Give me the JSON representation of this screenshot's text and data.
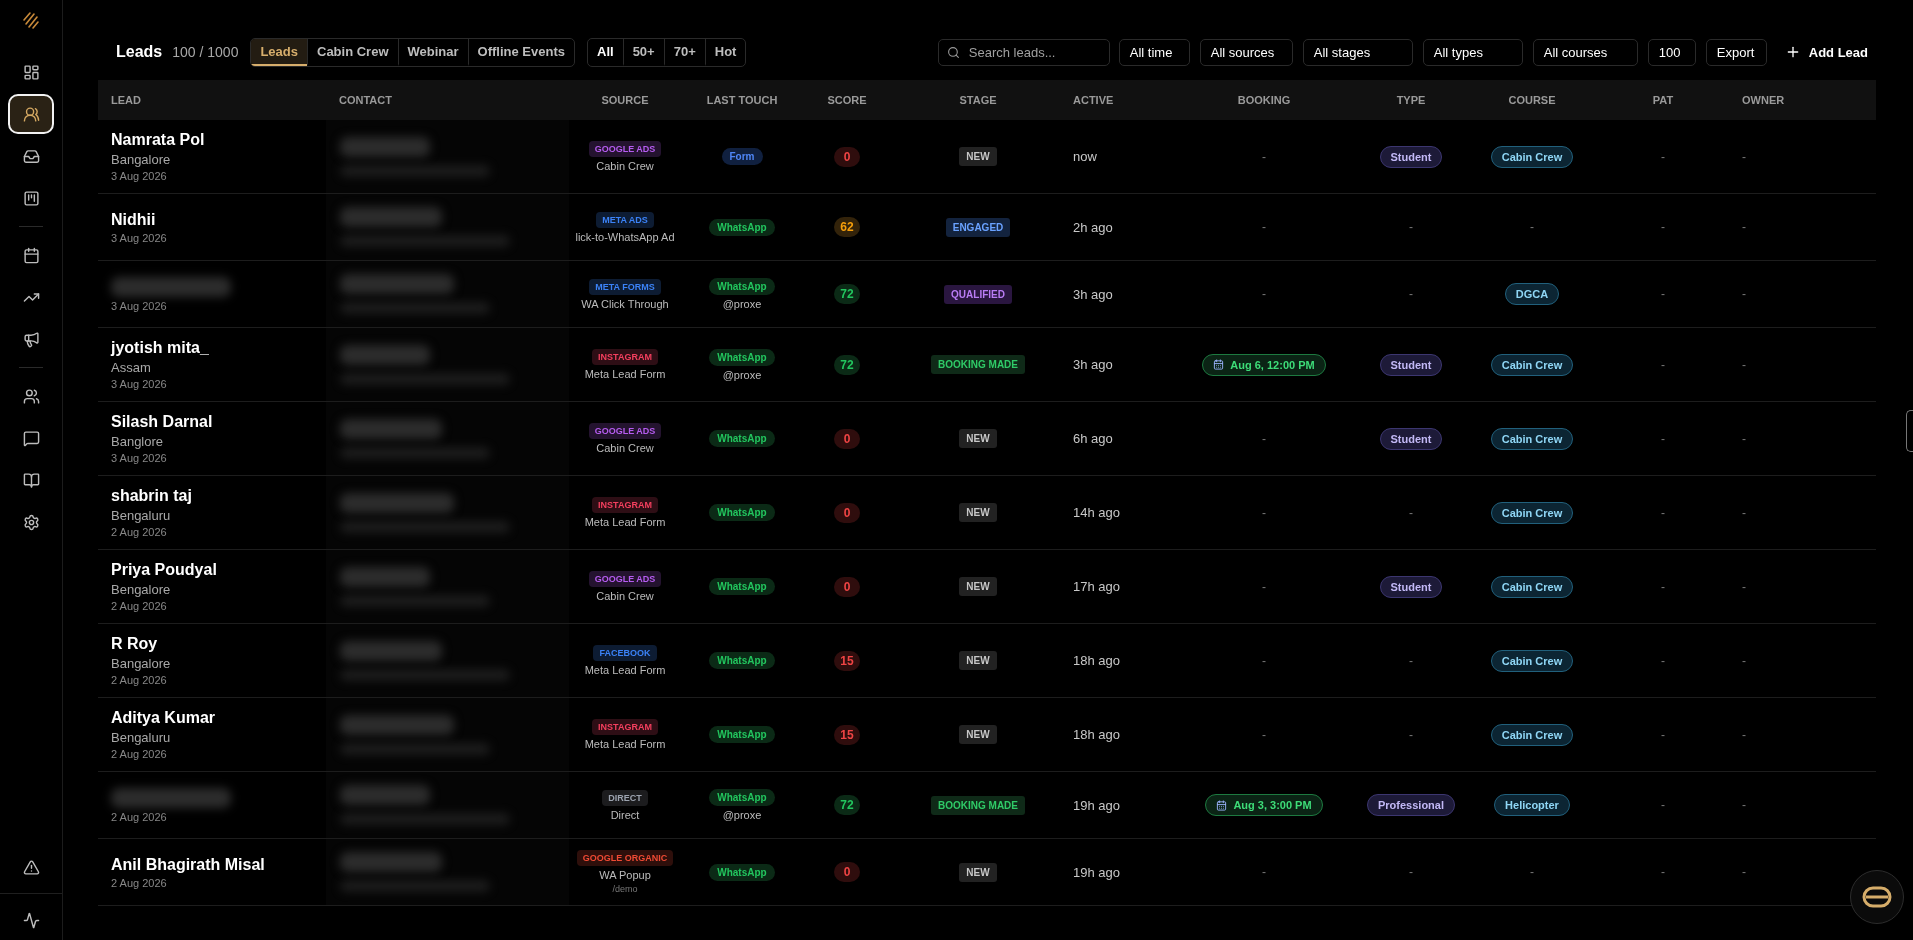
{
  "sidebar": {
    "items": [
      {
        "kind": "dashboard",
        "selected": false
      },
      {
        "kind": "leads",
        "selected": true
      },
      {
        "kind": "inbox",
        "selected": false
      },
      {
        "kind": "board",
        "selected": false
      },
      {
        "kind": "divider"
      },
      {
        "kind": "calendar",
        "selected": false
      },
      {
        "kind": "trend",
        "selected": false
      },
      {
        "kind": "megaphone",
        "selected": false
      },
      {
        "kind": "divider"
      },
      {
        "kind": "users",
        "selected": false
      },
      {
        "kind": "chat",
        "selected": false
      },
      {
        "kind": "book",
        "selected": false
      },
      {
        "kind": "settings",
        "selected": false
      }
    ],
    "bottom": [
      {
        "kind": "warning",
        "selected": false
      },
      {
        "kind": "pulse",
        "selected": false
      }
    ]
  },
  "header": {
    "title": "Leads",
    "count": "100 / 1000",
    "tabs": [
      {
        "label": "Leads",
        "selected": true
      },
      {
        "label": "Cabin Crew",
        "selected": false
      },
      {
        "label": "Webinar",
        "selected": false
      },
      {
        "label": "Offline Events",
        "selected": false
      }
    ],
    "score_filters": [
      {
        "label": "All",
        "selected": true
      },
      {
        "label": "50+",
        "selected": false
      },
      {
        "label": "70+",
        "selected": false
      },
      {
        "label": "Hot",
        "selected": false
      }
    ],
    "search": {
      "placeholder": "Search leads..."
    },
    "filters": [
      {
        "label": "All time",
        "kind": "time"
      },
      {
        "label": "All sources",
        "kind": "sources"
      },
      {
        "label": "All stages",
        "kind": "stages"
      },
      {
        "label": "All types",
        "kind": "types"
      },
      {
        "label": "All courses",
        "kind": "courses"
      },
      {
        "label": "100",
        "kind": "limit"
      }
    ],
    "export": "Export",
    "add": "Add Lead"
  },
  "table": {
    "columns": [
      "LEAD",
      "CONTACT",
      "SOURCE",
      "LAST TOUCH",
      "SCORE",
      "STAGE",
      "ACTIVE",
      "BOOKING",
      "TYPE",
      "COURSE",
      "PAT",
      "OWNER"
    ],
    "rows": [
      {
        "name": "Namrata Pol",
        "city": "Bangalore",
        "date": "3 Aug 2026",
        "source": {
          "tag": "GOOGLE ADS",
          "kind": "google_ads",
          "detail": "Cabin Crew"
        },
        "touch": {
          "label": "Form",
          "kind": "form"
        },
        "score": {
          "value": "0",
          "kind": "low"
        },
        "stage": {
          "label": "NEW",
          "kind": "new"
        },
        "active": "now",
        "booking": {
          "kind": "none",
          "label": "-"
        },
        "type": {
          "kind": "chip",
          "label": "Student"
        },
        "course": {
          "kind": "chip",
          "label": "Cabin Crew"
        },
        "pat": "-",
        "owner": "-"
      },
      {
        "name": "Nidhii",
        "date": "3 Aug 2026",
        "source": {
          "tag": "META ADS",
          "kind": "meta",
          "detail": "lick-to-WhatsApp Ad"
        },
        "touch": {
          "label": "WhatsApp",
          "kind": "whatsapp"
        },
        "score": {
          "value": "62",
          "kind": "mid"
        },
        "stage": {
          "label": "ENGAGED",
          "kind": "engaged"
        },
        "active": "2h ago",
        "booking": {
          "kind": "none",
          "label": "-"
        },
        "type": {
          "kind": "none",
          "label": "-"
        },
        "course": {
          "kind": "none",
          "label": "-"
        },
        "pat": "-",
        "owner": "-"
      },
      {
        "name_hidden": true,
        "date": "3 Aug 2026",
        "source": {
          "tag": "META FORMS",
          "kind": "meta",
          "detail": "WA Click Through"
        },
        "touch": {
          "label": "WhatsApp",
          "kind": "whatsapp",
          "handle": "@proxe"
        },
        "score": {
          "value": "72",
          "kind": "high"
        },
        "stage": {
          "label": "QUALIFIED",
          "kind": "qualified"
        },
        "active": "3h ago",
        "booking": {
          "kind": "none",
          "label": "-"
        },
        "type": {
          "kind": "none",
          "label": "-"
        },
        "course": {
          "kind": "chip",
          "label": "DGCA"
        },
        "pat": "-",
        "owner": "-"
      },
      {
        "name": "jyotish mita_",
        "city": "Assam",
        "date": "3 Aug 2026",
        "source": {
          "tag": "INSTAGRAM",
          "kind": "instagram",
          "detail": "Meta Lead Form"
        },
        "touch": {
          "label": "WhatsApp",
          "kind": "whatsapp",
          "handle": "@proxe"
        },
        "score": {
          "value": "72",
          "kind": "high"
        },
        "stage": {
          "label": "BOOKING MADE",
          "kind": "booking"
        },
        "active": "3h ago",
        "booking": {
          "kind": "chip",
          "label": "Aug 6, 12:00 PM"
        },
        "type": {
          "kind": "chip",
          "label": "Student"
        },
        "course": {
          "kind": "chip",
          "label": "Cabin Crew"
        },
        "pat": "-",
        "owner": "-"
      },
      {
        "name": "Silash Darnal",
        "city": "Banglore",
        "date": "3 Aug 2026",
        "source": {
          "tag": "GOOGLE ADS",
          "kind": "google_ads",
          "detail": "Cabin Crew"
        },
        "touch": {
          "label": "WhatsApp",
          "kind": "whatsapp"
        },
        "score": {
          "value": "0",
          "kind": "low"
        },
        "stage": {
          "label": "NEW",
          "kind": "new"
        },
        "active": "6h ago",
        "booking": {
          "kind": "none",
          "label": "-"
        },
        "type": {
          "kind": "chip",
          "label": "Student"
        },
        "course": {
          "kind": "chip",
          "label": "Cabin Crew"
        },
        "pat": "-",
        "owner": "-"
      },
      {
        "name": "shabrin taj",
        "city": "Bengaluru",
        "date": "2 Aug 2026",
        "source": {
          "tag": "INSTAGRAM",
          "kind": "instagram",
          "detail": "Meta Lead Form"
        },
        "touch": {
          "label": "WhatsApp",
          "kind": "whatsapp"
        },
        "score": {
          "value": "0",
          "kind": "low"
        },
        "stage": {
          "label": "NEW",
          "kind": "new"
        },
        "active": "14h ago",
        "booking": {
          "kind": "none",
          "label": "-"
        },
        "type": {
          "kind": "none",
          "label": "-"
        },
        "course": {
          "kind": "chip",
          "label": "Cabin Crew"
        },
        "pat": "-",
        "owner": "-"
      },
      {
        "name": "Priya Poudyal",
        "city": "Bengalore",
        "date": "2 Aug 2026",
        "source": {
          "tag": "GOOGLE ADS",
          "kind": "google_ads",
          "detail": "Cabin Crew"
        },
        "touch": {
          "label": "WhatsApp",
          "kind": "whatsapp"
        },
        "score": {
          "value": "0",
          "kind": "low"
        },
        "stage": {
          "label": "NEW",
          "kind": "new"
        },
        "active": "17h ago",
        "booking": {
          "kind": "none",
          "label": "-"
        },
        "type": {
          "kind": "chip",
          "label": "Student"
        },
        "course": {
          "kind": "chip",
          "label": "Cabin Crew"
        },
        "pat": "-",
        "owner": "-"
      },
      {
        "name": "R Roy",
        "city": "Bangalore",
        "date": "2 Aug 2026",
        "source": {
          "tag": "FACEBOOK",
          "kind": "meta",
          "detail": "Meta Lead Form"
        },
        "touch": {
          "label": "WhatsApp",
          "kind": "whatsapp"
        },
        "score": {
          "value": "15",
          "kind": "low"
        },
        "stage": {
          "label": "NEW",
          "kind": "new"
        },
        "active": "18h ago",
        "booking": {
          "kind": "none",
          "label": "-"
        },
        "type": {
          "kind": "none",
          "label": "-"
        },
        "course": {
          "kind": "chip",
          "label": "Cabin Crew"
        },
        "pat": "-",
        "owner": "-"
      },
      {
        "name": "Aditya Kumar",
        "city": "Bengaluru",
        "date": "2 Aug 2026",
        "source": {
          "tag": "INSTAGRAM",
          "kind": "instagram",
          "detail": "Meta Lead Form"
        },
        "touch": {
          "label": "WhatsApp",
          "kind": "whatsapp"
        },
        "score": {
          "value": "15",
          "kind": "low"
        },
        "stage": {
          "label": "NEW",
          "kind": "new"
        },
        "active": "18h ago",
        "booking": {
          "kind": "none",
          "label": "-"
        },
        "type": {
          "kind": "none",
          "label": "-"
        },
        "course": {
          "kind": "chip",
          "label": "Cabin Crew"
        },
        "pat": "-",
        "owner": "-"
      },
      {
        "name_hidden": true,
        "date": "2 Aug 2026",
        "source": {
          "tag": "DIRECT",
          "kind": "direct",
          "detail": "Direct"
        },
        "touch": {
          "label": "WhatsApp",
          "kind": "whatsapp",
          "handle": "@proxe"
        },
        "score": {
          "value": "72",
          "kind": "high"
        },
        "stage": {
          "label": "BOOKING MADE",
          "kind": "booking"
        },
        "active": "19h ago",
        "booking": {
          "kind": "chip",
          "label": "Aug 3, 3:00 PM"
        },
        "type": {
          "kind": "chip",
          "label": "Professional"
        },
        "course": {
          "kind": "chip",
          "label": "Helicopter"
        },
        "pat": "-",
        "owner": "-"
      },
      {
        "name": "Anil Bhagirath Misal",
        "date": "2 Aug 2026",
        "source": {
          "tag": "GOOGLE ORGANIC",
          "kind": "google_organic",
          "detail": "WA Popup",
          "sub": "/demo"
        },
        "touch": {
          "label": "WhatsApp",
          "kind": "whatsapp"
        },
        "score": {
          "value": "0",
          "kind": "low"
        },
        "stage": {
          "label": "NEW",
          "kind": "new"
        },
        "active": "19h ago",
        "booking": {
          "kind": "none",
          "label": "-"
        },
        "type": {
          "kind": "none",
          "label": "-"
        },
        "course": {
          "kind": "none",
          "label": "-"
        },
        "pat": "-",
        "owner": "-"
      }
    ]
  }
}
